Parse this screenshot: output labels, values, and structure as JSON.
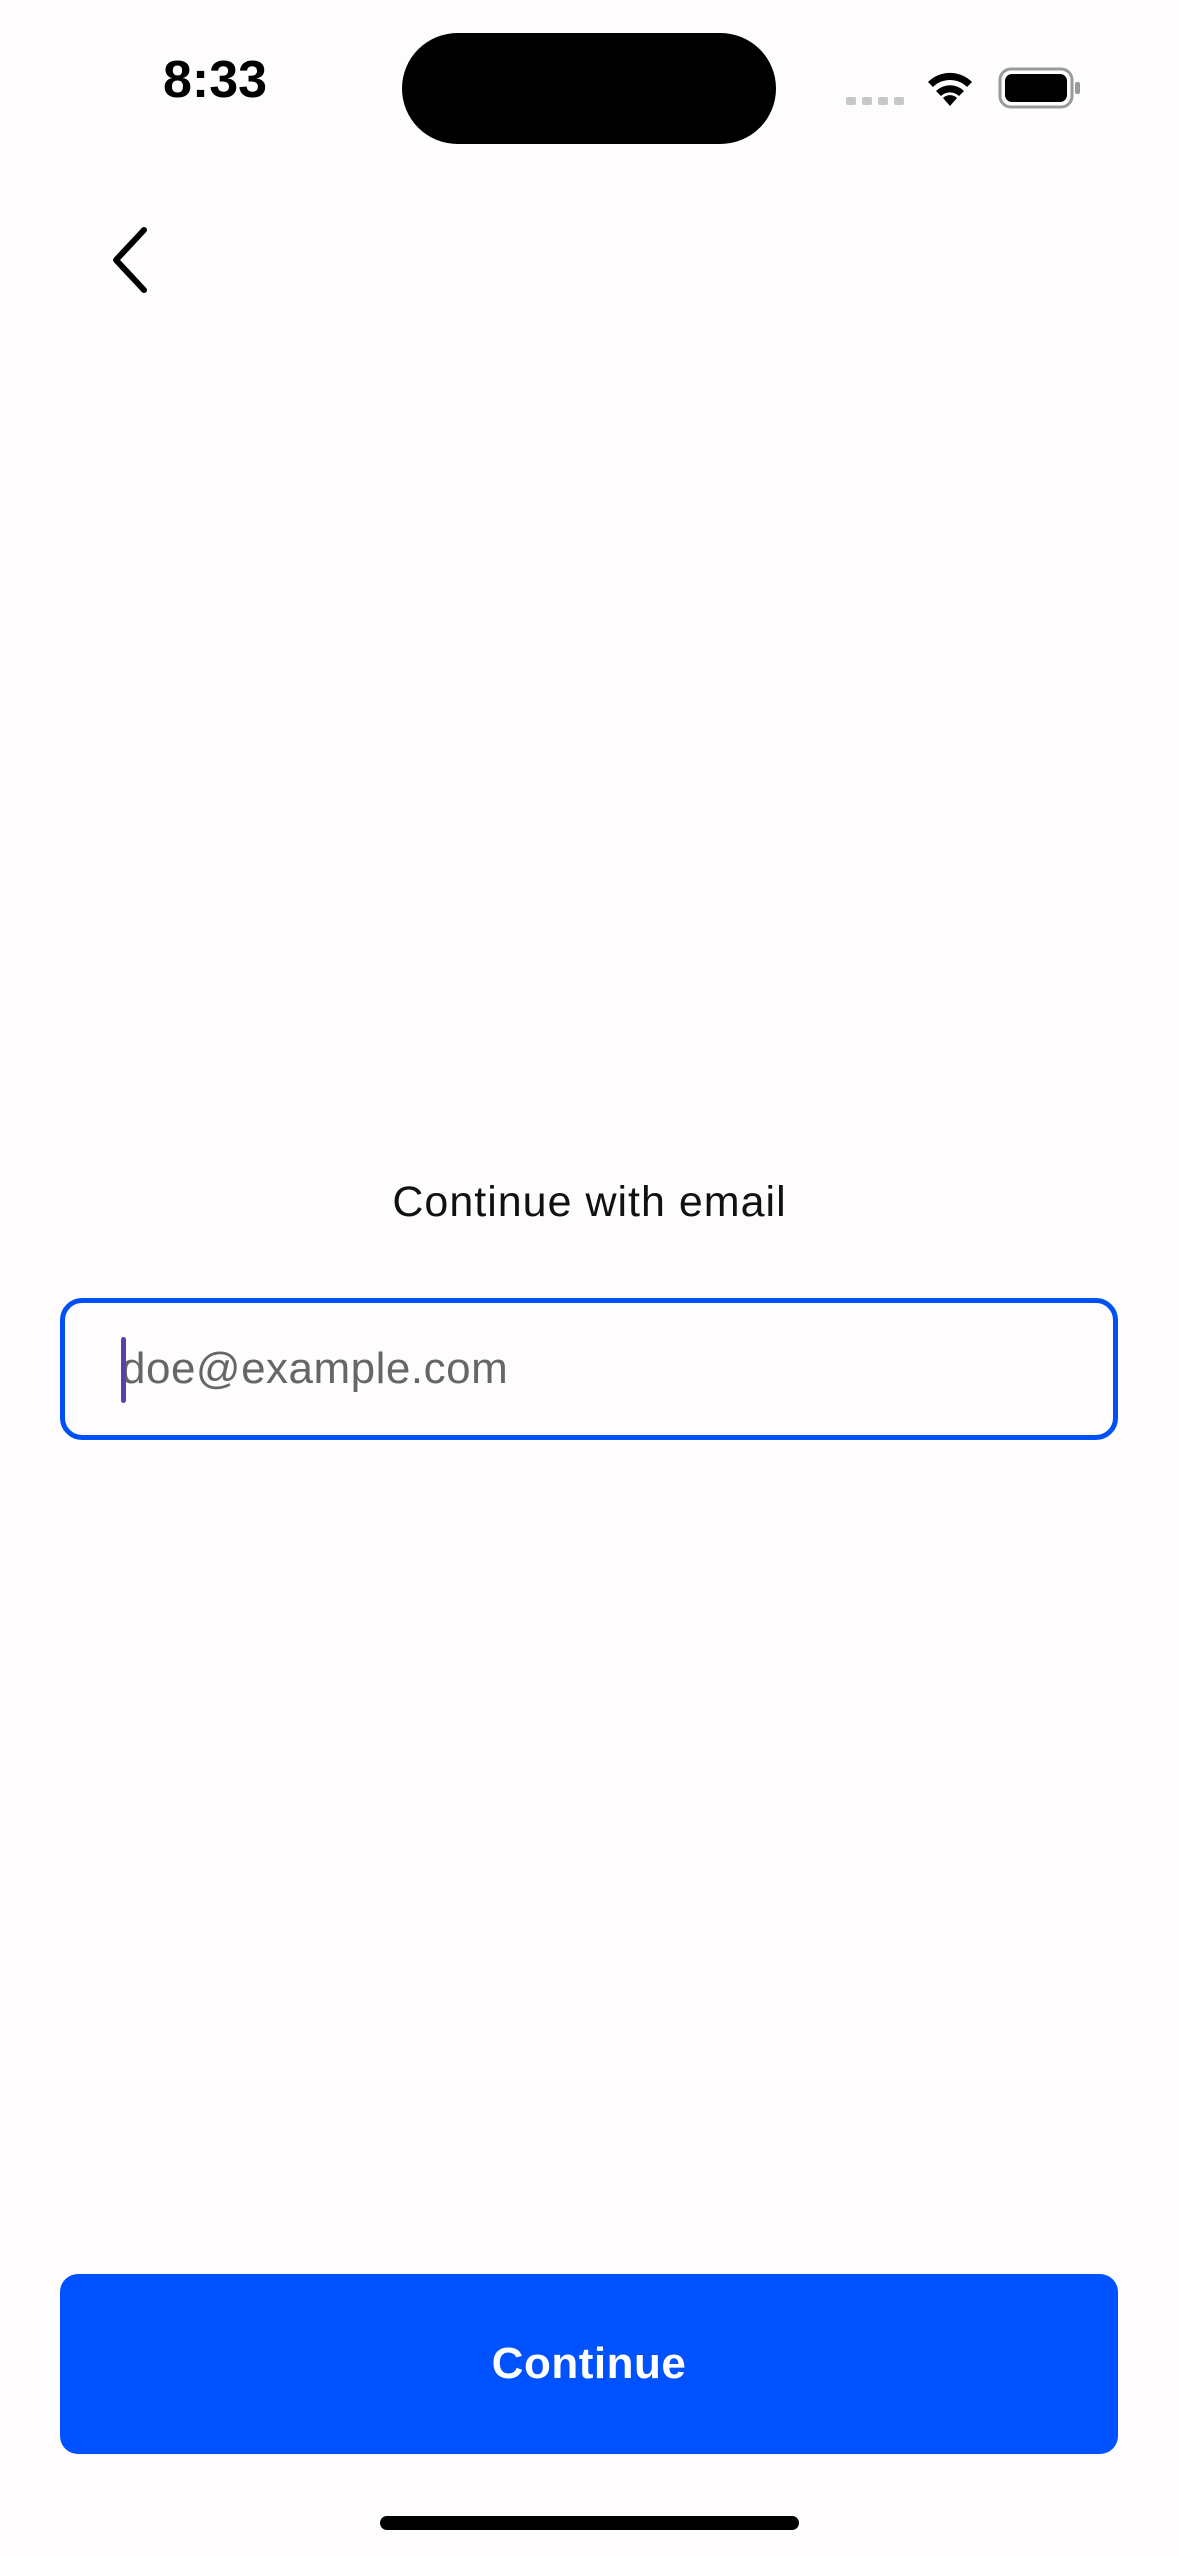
{
  "status_bar": {
    "time": "8:33",
    "signal_icon": "signal-dots-icon",
    "wifi_icon": "wifi-icon",
    "battery_icon": "battery-icon"
  },
  "nav": {
    "back_icon": "chevron-left-icon"
  },
  "main": {
    "prompt": "Continue with email",
    "email_field": {
      "value": "",
      "placeholder": "doe@example.com"
    },
    "continue_label": "Continue"
  },
  "colors": {
    "accent": "#0051FE",
    "field_border": "#0051F5",
    "background": "#FFFCFE",
    "caret": "#5A3FA8"
  }
}
